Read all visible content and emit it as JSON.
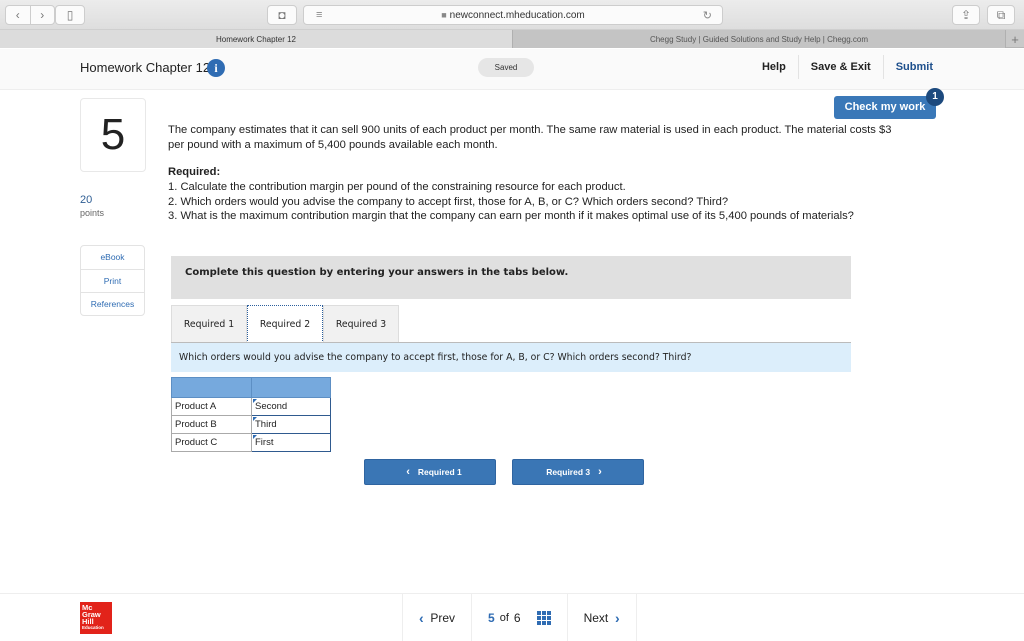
{
  "browser": {
    "url": "newconnect.mheducation.com",
    "tabs": [
      {
        "label": "Homework Chapter 12",
        "active": true
      },
      {
        "label": "Chegg Study | Guided Solutions and Study Help | Chegg.com",
        "active": false
      }
    ],
    "icons": {
      "back": "‹",
      "forward": "›",
      "sidebar": "▯",
      "shield": "◘",
      "reader": "≡",
      "lock": "🔒",
      "reload": "↻",
      "share": "⇪",
      "tabs": "⧉",
      "new_tab": "+"
    }
  },
  "header": {
    "title": "Homework Chapter 12",
    "info_icon": "i",
    "saved_label": "Saved",
    "links": {
      "help": "Help",
      "save_exit": "Save & Exit",
      "submit": "Submit"
    }
  },
  "check_work": {
    "label": "Check my work",
    "badge": "1"
  },
  "question": {
    "number": "5",
    "points_value": "20",
    "points_label": "points",
    "side_links": [
      "eBook",
      "Print",
      "References"
    ],
    "intro": "The company estimates that it can sell 900 units of each product per month. The same raw material is used in each product. The material costs $3 per pound with a maximum of 5,400 pounds available each month.",
    "required_title": "Required:",
    "required_items": [
      "1. Calculate the contribution margin per pound of the constraining resource for each product.",
      "2. Which orders would you advise the company to accept first, those for A, B, or C? Which orders second? Third?",
      "3. What is the maximum contribution margin that the company can earn per month if it makes optimal use of its 5,400 pounds of materials?"
    ]
  },
  "answer_area": {
    "instruction": "Complete this question by entering your answers in the tabs below.",
    "tabs": [
      {
        "label": "Required 1",
        "active": false
      },
      {
        "label": "Required 2",
        "active": true
      },
      {
        "label": "Required 3",
        "active": false
      }
    ],
    "prompt": "Which orders would you advise the company to accept first, those for A, B, or C? Which orders second? Third?",
    "table": {
      "rows": [
        {
          "product": "Product A",
          "answer": "Second"
        },
        {
          "product": "Product B",
          "answer": "Third"
        },
        {
          "product": "Product C",
          "answer": "First"
        }
      ]
    },
    "prev_button": "Required 1",
    "next_button": "Required 3"
  },
  "footer": {
    "logo_lines": [
      "Mc",
      "Graw",
      "Hill"
    ],
    "logo_sub": "Education",
    "prev": "Prev",
    "current": "5",
    "of_label": "of",
    "total": "6",
    "next": "Next"
  }
}
